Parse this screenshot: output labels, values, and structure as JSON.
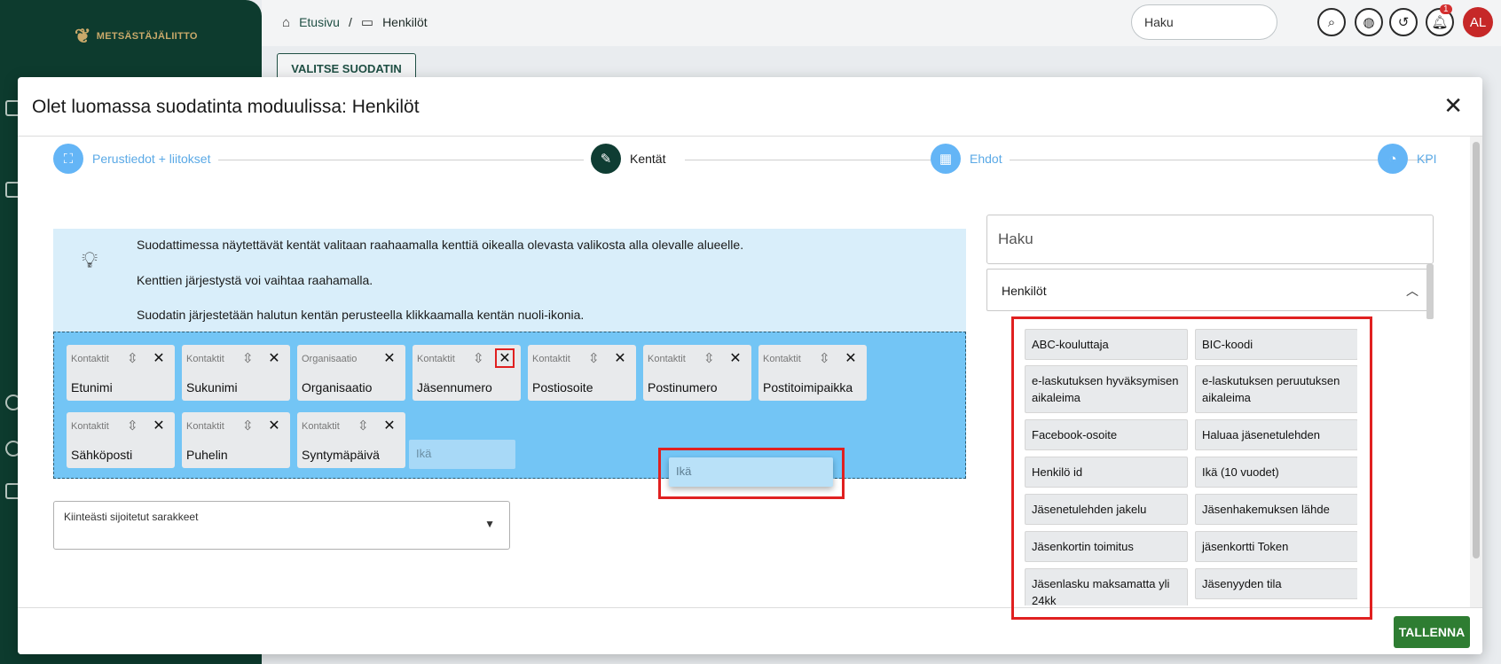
{
  "app": {
    "logo_text": "METSÄSTÄJÄLIITTO",
    "breadcrumb": {
      "home": "Etusivu",
      "separator": "/",
      "current": "Henkilöt"
    },
    "search_placeholder": "Haku",
    "notification_count": "1",
    "avatar_initials": "AL",
    "choose_filter_label": "VALITSE SUODATIN"
  },
  "modal": {
    "title": "Olet luomassa suodatinta moduulissa: Henkilöt",
    "close_label": "✕",
    "save_label": "TALLENNA",
    "steps": [
      {
        "label": "Perustiedot + liitokset",
        "icon": "frame-icon"
      },
      {
        "label": "Kentät",
        "icon": "pencil-icon"
      },
      {
        "label": "Ehdot",
        "icon": "sliders-icon"
      },
      {
        "label": "KPI",
        "icon": "chart-icon"
      }
    ],
    "info_lines": [
      "Suodattimessa näytettävät kentät valitaan raahaamalla kenttiä oikealla olevasta valikosta alla olevalle alueelle.",
      "Kenttien järjestystä voi vaihtaa raahamalla.",
      "Suodatin järjestetään halutun kentän perusteella klikkaamalla kentän nuoli-ikonia."
    ],
    "selected_fields": [
      {
        "category": "Kontaktit",
        "name": "Etunimi"
      },
      {
        "category": "Kontaktit",
        "name": "Sukunimi"
      },
      {
        "category": "Organisaatio",
        "name": "Organisaatio"
      },
      {
        "category": "Kontaktit",
        "name": "Jäsennumero"
      },
      {
        "category": "Kontaktit",
        "name": "Postiosoite"
      },
      {
        "category": "Kontaktit",
        "name": "Postinumero"
      },
      {
        "category": "Kontaktit",
        "name": "Postitoimipaikka"
      },
      {
        "category": "Kontaktit",
        "name": "Sähköposti"
      },
      {
        "category": "Kontaktit",
        "name": "Puhelin"
      },
      {
        "category": "Kontaktit",
        "name": "Syntymäpäivä"
      }
    ],
    "drop_placeholder": "Ikä",
    "dragging_item": "Ikä",
    "fixed_columns_label": "Kiinteästi sijoitetut sarakkeet",
    "right_panel": {
      "search_placeholder": "Haku",
      "group_label": "Henkilöt",
      "available_fields": [
        "ABC-kouluttaja",
        "BIC-koodi",
        "e-laskutuksen hyväksymisen aikaleima",
        "e-laskutuksen peruutuksen aikaleima",
        "Facebook-osoite",
        "Haluaa jäsenetulehden",
        "Henkilö id",
        "Ikä (10 vuodet)",
        "Jäsenetulehden jakelu",
        "Jäsenhakemuksen lähde",
        "Jäsenkortin toimitus",
        "jäsenkortti Token",
        "Jäsenlasku maksamatta yli 24kk",
        "Jäsenyyden tila"
      ]
    }
  }
}
